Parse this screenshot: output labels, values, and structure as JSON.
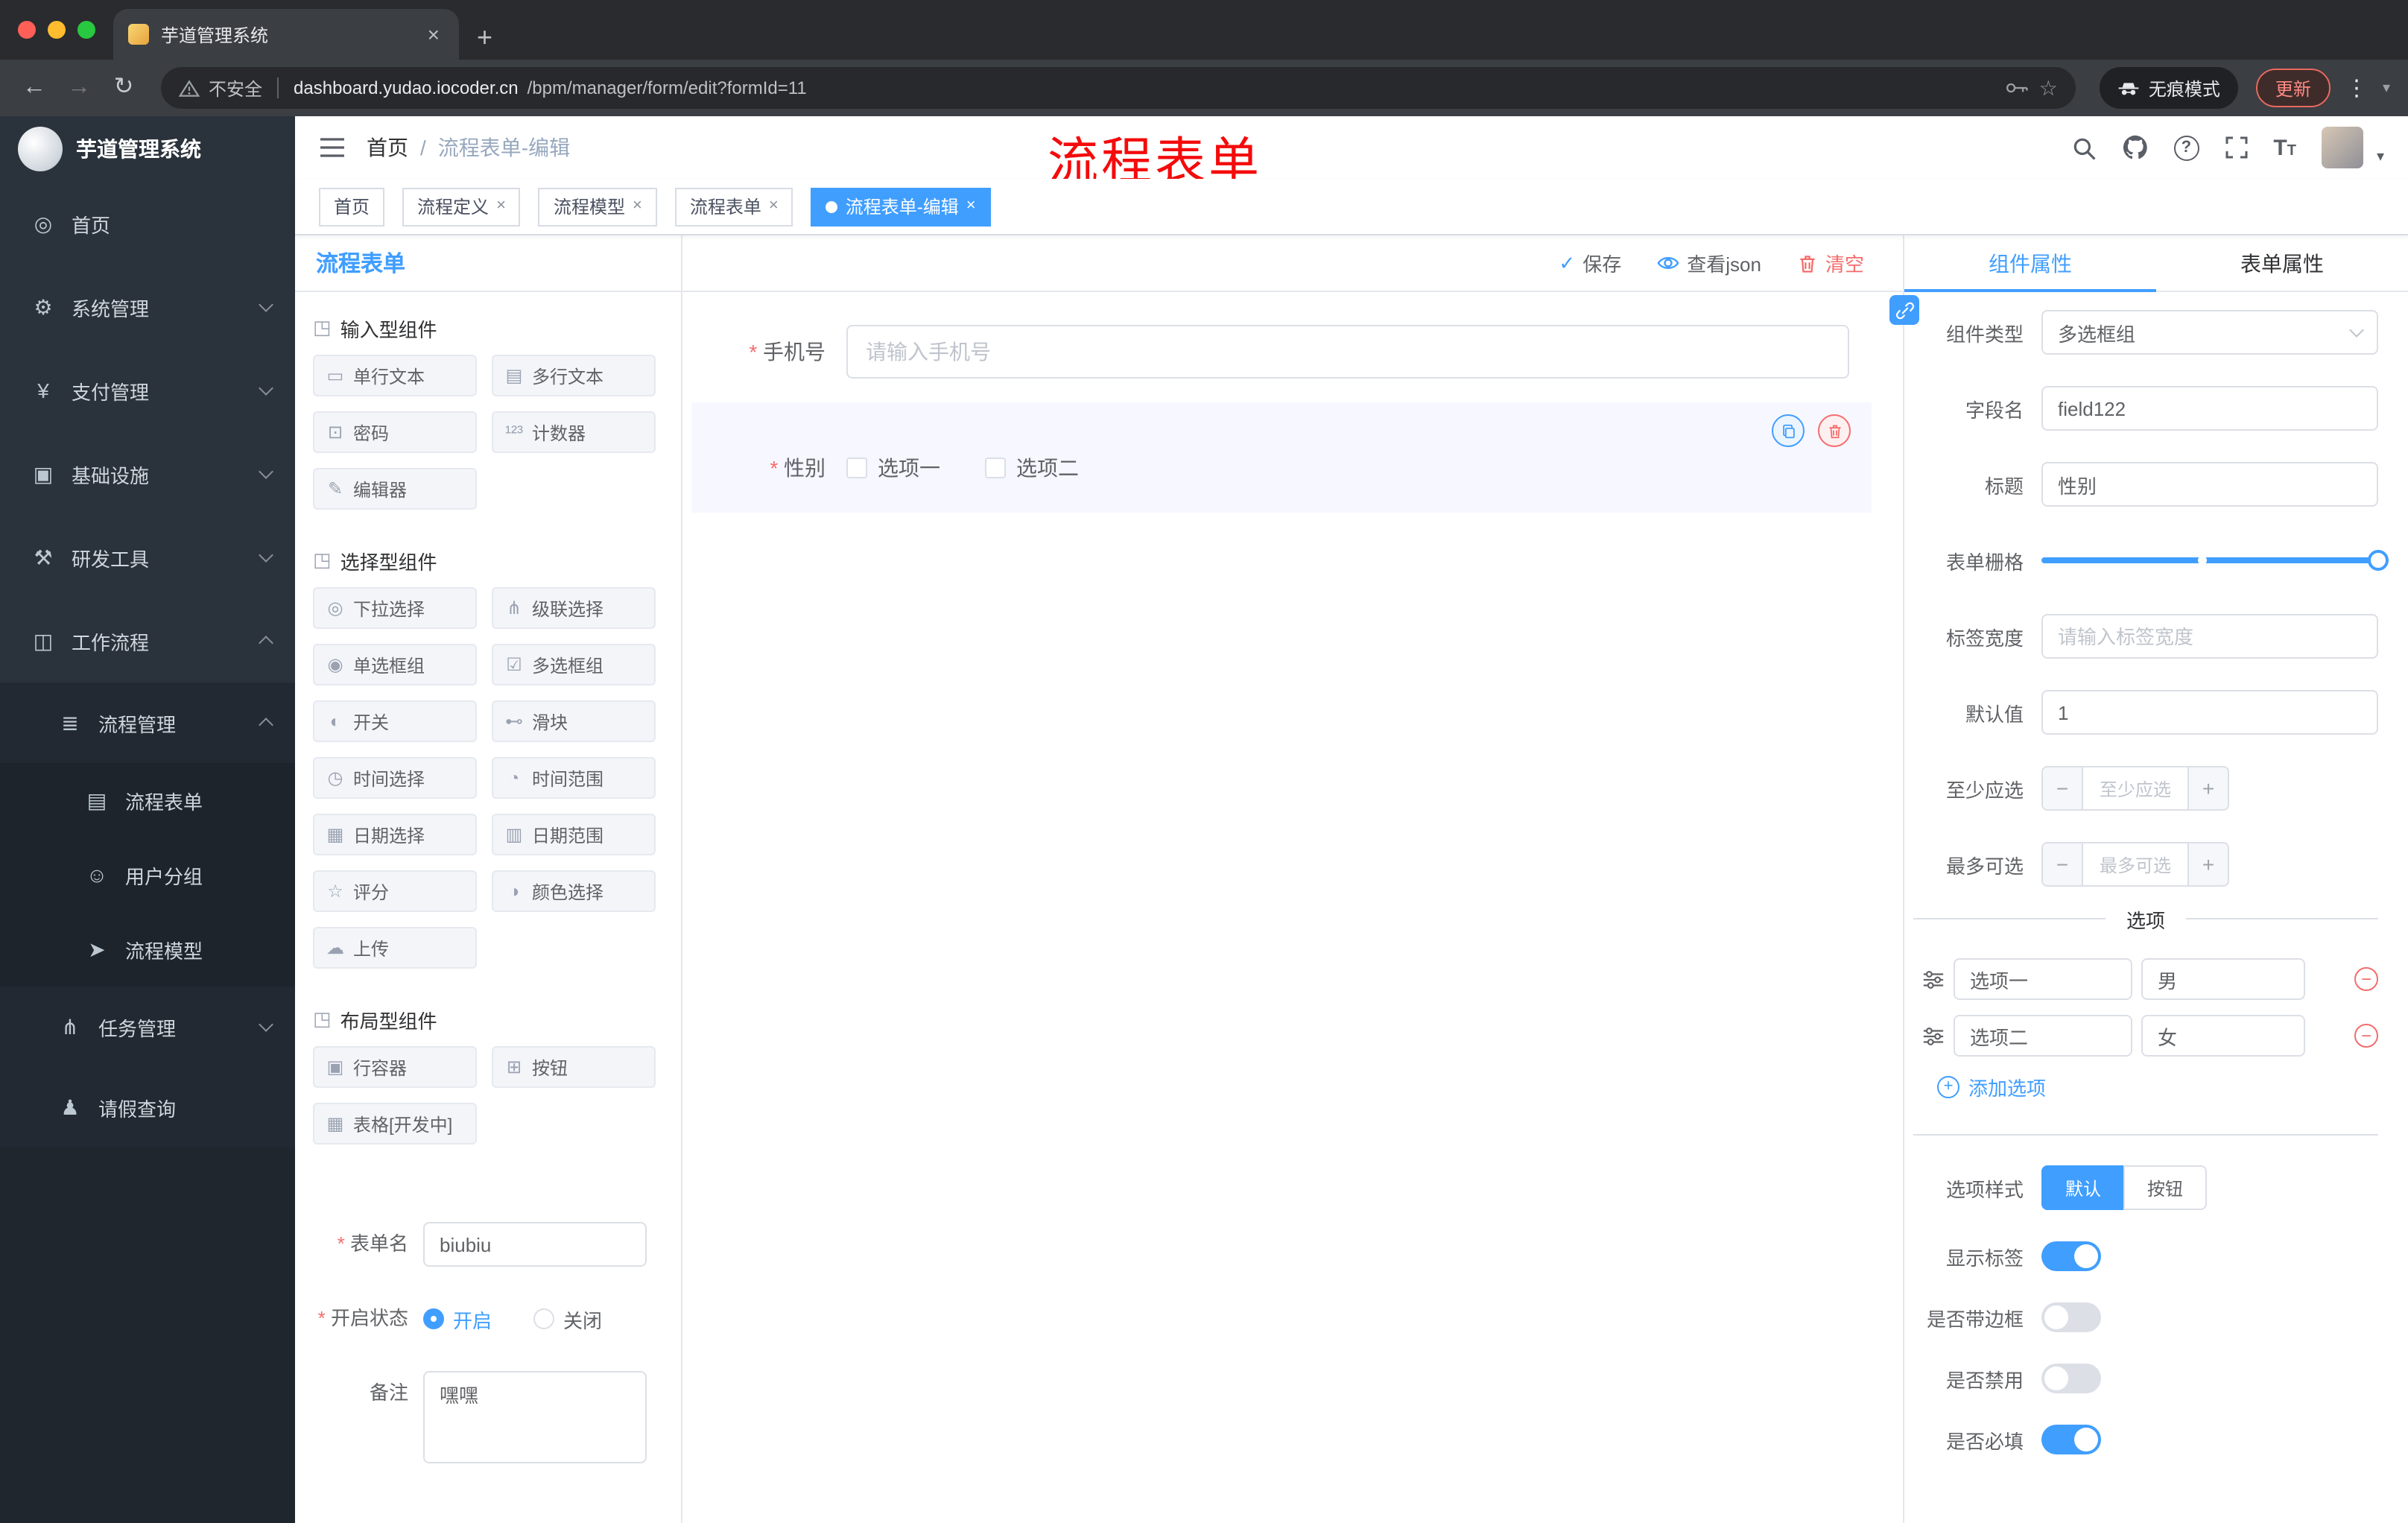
{
  "theme": {
    "primary": "#409eff",
    "danger": "#f56c6c",
    "annotation_red": "#f40b0b",
    "tag_active": "#409eff"
  },
  "browser": {
    "tab_title": "芋道管理系统",
    "security_label": "不安全",
    "url_domain": "dashboard.yudao.iocoder.cn",
    "url_path": "/bpm/manager/form/edit?formId=11",
    "incognito_label": "无痕模式",
    "update_label": "更新"
  },
  "sidebar": {
    "logo_title": "芋道管理系统",
    "items": [
      {
        "label": "首页",
        "icon": "dashboard-icon",
        "glyph": "◎",
        "level": 1
      },
      {
        "label": "系统管理",
        "icon": "gear-icon",
        "glyph": "⚙",
        "level": 1,
        "chevron": "down"
      },
      {
        "label": "支付管理",
        "icon": "yen-icon",
        "glyph": "¥",
        "level": 1,
        "chevron": "down"
      },
      {
        "label": "基础设施",
        "icon": "monitor-icon",
        "glyph": "▣",
        "level": 1,
        "chevron": "down"
      },
      {
        "label": "研发工具",
        "icon": "tools-icon",
        "glyph": "⚒",
        "level": 1,
        "chevron": "down"
      },
      {
        "label": "工作流程",
        "icon": "workflow-icon",
        "glyph": "◫",
        "level": 1,
        "chevron": "up"
      },
      {
        "label": "流程管理",
        "icon": "list-icon",
        "glyph": "≣",
        "level": 2,
        "chevron": "up"
      },
      {
        "label": "流程表单",
        "icon": "form-icon",
        "glyph": "▤",
        "level": 3
      },
      {
        "label": "用户分组",
        "icon": "users-icon",
        "glyph": "☺",
        "level": 3
      },
      {
        "label": "流程模型",
        "icon": "send-icon",
        "glyph": "➤",
        "level": 3
      },
      {
        "label": "任务管理",
        "icon": "tree-icon",
        "glyph": "⋔",
        "level": 2,
        "chevron": "down"
      },
      {
        "label": "请假查询",
        "icon": "person-icon",
        "glyph": "♟",
        "level": 2
      }
    ]
  },
  "header": {
    "breadcrumb_home": "首页",
    "breadcrumb_current": "流程表单-编辑",
    "annotation": "流程表单",
    "right_icons": [
      "search-icon",
      "github-icon",
      "help-icon",
      "fullscreen-icon",
      "font-size-icon",
      "avatar",
      "caret-down-icon"
    ]
  },
  "tags": [
    {
      "label": "首页",
      "closable": false,
      "active": false
    },
    {
      "label": "流程定义",
      "closable": true,
      "active": false
    },
    {
      "label": "流程模型",
      "closable": true,
      "active": false
    },
    {
      "label": "流程表单",
      "closable": true,
      "active": false
    },
    {
      "label": "流程表单-编辑",
      "closable": true,
      "active": true
    }
  ],
  "designer": {
    "panel_title": "流程表单",
    "toolbar": {
      "save": "保存",
      "view_json": "查看json",
      "clear": "清空"
    },
    "groups": [
      {
        "title": "输入型组件",
        "icon": "component-icon",
        "icon_glyph": "◳",
        "items": [
          {
            "label": "单行文本",
            "icon": "text-field-icon",
            "glyph": "▭"
          },
          {
            "label": "多行文本",
            "icon": "textarea-icon",
            "glyph": "▤"
          },
          {
            "label": "密码",
            "icon": "lock-icon",
            "glyph": "⊡"
          },
          {
            "label": "计数器",
            "icon": "counter-icon",
            "glyph": "¹²³"
          },
          {
            "label": "编辑器",
            "icon": "editor-icon",
            "glyph": "✎"
          }
        ]
      },
      {
        "title": "选择型组件",
        "icon": "component-icon",
        "icon_glyph": "◳",
        "items": [
          {
            "label": "下拉选择",
            "icon": "select-icon",
            "glyph": "◎"
          },
          {
            "label": "级联选择",
            "icon": "cascader-icon",
            "glyph": "⋔"
          },
          {
            "label": "单选框组",
            "icon": "radio-group-icon",
            "glyph": "◉"
          },
          {
            "label": "多选框组",
            "icon": "checkbox-group-icon",
            "glyph": "☑"
          },
          {
            "label": "开关",
            "icon": "switch-icon",
            "glyph": "◐"
          },
          {
            "label": "滑块",
            "icon": "slider-icon",
            "glyph": "⊷"
          },
          {
            "label": "时间选择",
            "icon": "time-icon",
            "glyph": "◷"
          },
          {
            "label": "时间范围",
            "icon": "time-range-icon",
            "glyph": "◔"
          },
          {
            "label": "日期选择",
            "icon": "date-icon",
            "glyph": "▦"
          },
          {
            "label": "日期范围",
            "icon": "date-range-icon",
            "glyph": "▥"
          },
          {
            "label": "评分",
            "icon": "rate-icon",
            "glyph": "☆"
          },
          {
            "label": "颜色选择",
            "icon": "color-icon",
            "glyph": "◑"
          },
          {
            "label": "上传",
            "icon": "upload-icon",
            "glyph": "☁"
          }
        ]
      },
      {
        "title": "布局型组件",
        "icon": "component-icon",
        "icon_glyph": "◳",
        "items": [
          {
            "label": "行容器",
            "icon": "row-container-icon",
            "glyph": "▣"
          },
          {
            "label": "按钮",
            "icon": "button-icon",
            "glyph": "⊞"
          },
          {
            "label": "表格[开发中]",
            "icon": "table-icon",
            "glyph": "▦"
          }
        ]
      }
    ],
    "meta": {
      "name_label": "表单名",
      "name_value": "biubiu",
      "status_label": "开启状态",
      "status_on": "开启",
      "status_off": "关闭",
      "status_selected": "开启",
      "remark_label": "备注",
      "remark_value": "嘿嘿"
    },
    "canvas": {
      "phone_label": "手机号",
      "phone_placeholder": "请输入手机号",
      "gender_label": "性别",
      "gender_options": [
        "选项一",
        "选项二"
      ]
    }
  },
  "properties": {
    "tab_component": "组件属性",
    "tab_form": "表单属性",
    "active_tab": "组件属性",
    "type_label": "组件类型",
    "type_value": "多选框组",
    "field_label": "字段名",
    "field_value": "field122",
    "title_label": "标题",
    "title_value": "性别",
    "grid_label": "表单栅格",
    "width_label": "标签宽度",
    "width_placeholder": "请输入标签宽度",
    "default_label": "默认值",
    "default_value": "1",
    "min_label": "至少应选",
    "min_placeholder": "至少应选",
    "max_label": "最多可选",
    "max_placeholder": "最多可选",
    "options_divider": "选项",
    "options": [
      {
        "name": "选项一",
        "value": "男"
      },
      {
        "name": "选项二",
        "value": "女"
      }
    ],
    "add_option": "添加选项",
    "style_label": "选项样式",
    "style_default": "默认",
    "style_button": "按钮",
    "style_selected": "默认",
    "show_label": "显示标签",
    "show_value": true,
    "border_label": "是否带边框",
    "border_value": false,
    "disabled_label": "是否禁用",
    "disabled_value": false,
    "required_label": "是否必填",
    "required_value": true
  }
}
